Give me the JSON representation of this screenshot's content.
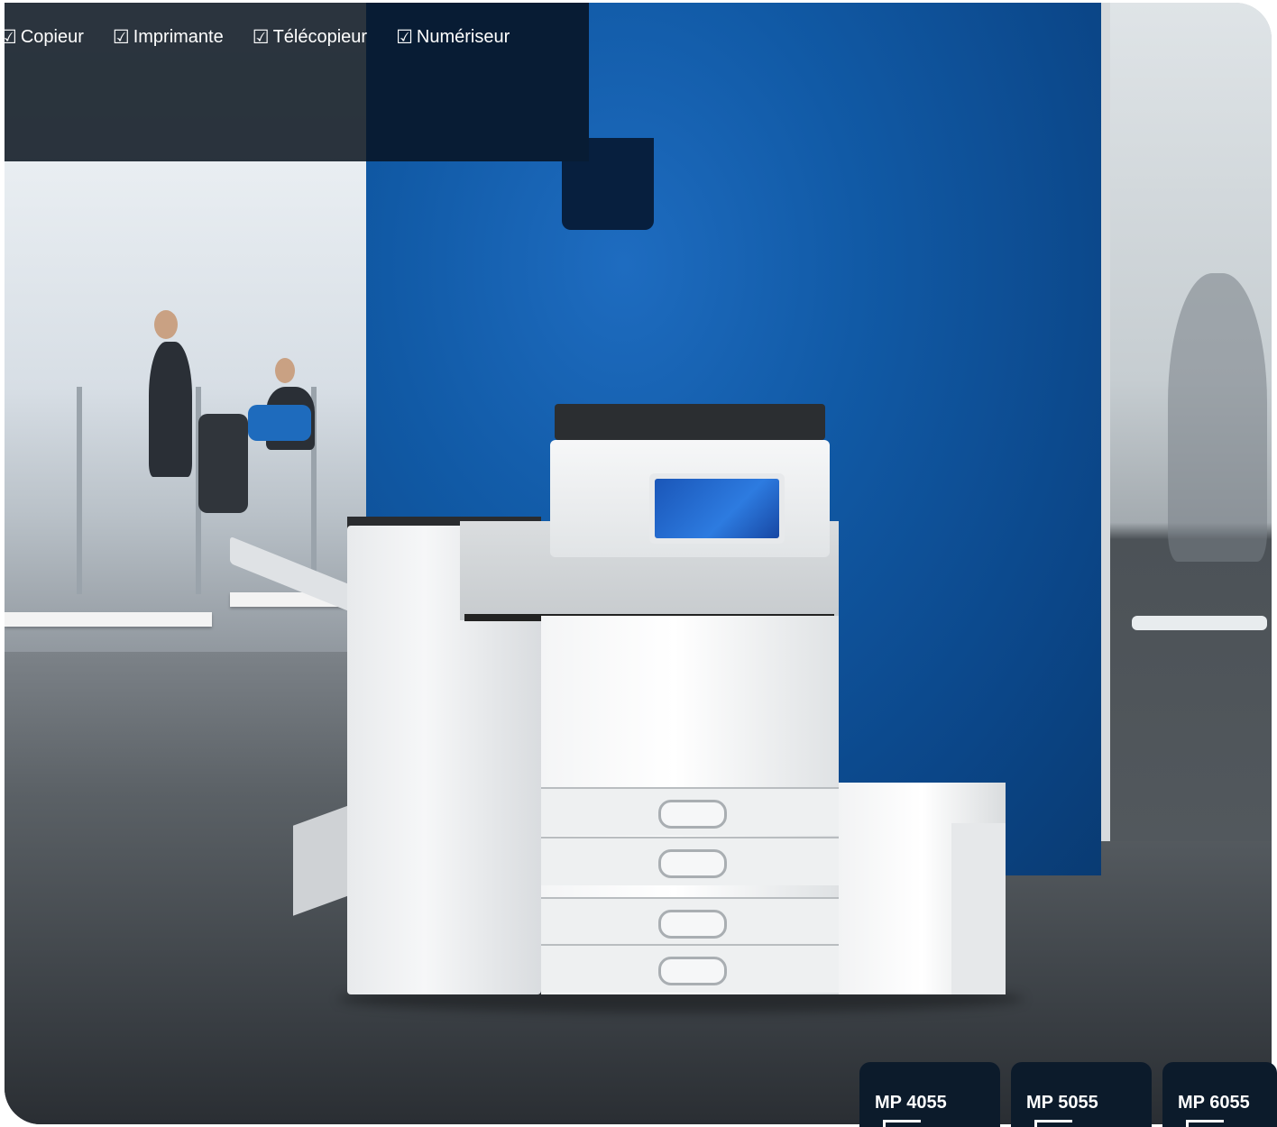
{
  "features": [
    {
      "check": "☑",
      "label": "Copieur"
    },
    {
      "check": "☑",
      "label": "Imprimante"
    },
    {
      "check": "☑",
      "label": "Télécopieur"
    },
    {
      "check": "☑",
      "label": "Numériseur"
    }
  ],
  "models": [
    "MP 4055",
    "MP 5055",
    "MP 6055"
  ],
  "colors": {
    "wall_blue": "#115aa6",
    "panel_dark": "#1a242e",
    "tab_bg": "#0c1b2b",
    "text_light": "#ffffff"
  }
}
